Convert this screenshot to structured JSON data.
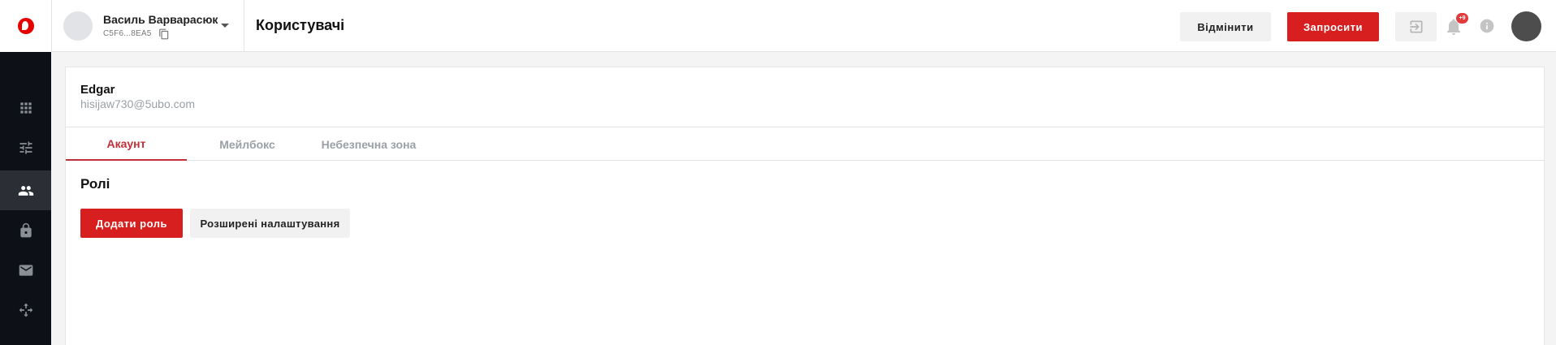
{
  "account": {
    "name": "Василь Варварасюк",
    "id": "C5F6...8EA5"
  },
  "header": {
    "page_title": "Користувачі",
    "cancel_label": "Відмінити",
    "invite_label": "Запросити",
    "notification_badge": "+9"
  },
  "sidebar": {
    "items": [
      {
        "icon": "apps-grid-icon",
        "active": false
      },
      {
        "icon": "sliders-icon",
        "active": false
      },
      {
        "icon": "users-icon",
        "active": true
      },
      {
        "icon": "lock-icon",
        "active": false
      },
      {
        "icon": "mail-icon",
        "active": false
      },
      {
        "icon": "move-arrows-icon",
        "active": false
      }
    ]
  },
  "user": {
    "name": "Edgar",
    "email": "hisijaw730@5ubo.com"
  },
  "tabs": [
    {
      "label": "Акаунт",
      "active": true
    },
    {
      "label": "Мейлбокс",
      "active": false
    },
    {
      "label": "Небезпечна зона",
      "active": false
    }
  ],
  "roles": {
    "title": "Ролі",
    "add_role_label": "Додати роль",
    "advanced_label": "Розширені налаштування"
  },
  "colors": {
    "brand_red": "#d81f1f",
    "active_tab": "#c1303a",
    "sidebar_bg": "#0d1117"
  }
}
